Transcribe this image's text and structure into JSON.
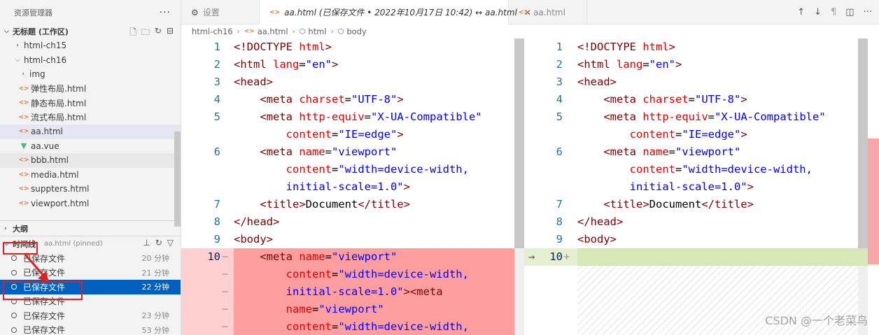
{
  "sidebar": {
    "title": "资源管理器",
    "more": "···",
    "workspace": "无标题 (工作区)",
    "items": [
      {
        "label": "html-ch15",
        "type": "folder",
        "open": false,
        "indent": 1
      },
      {
        "label": "html-ch16",
        "type": "folder",
        "open": true,
        "indent": 1
      },
      {
        "label": "img",
        "type": "folder",
        "open": false,
        "indent": 2
      },
      {
        "label": "弹性布局.html",
        "type": "html",
        "indent": 2
      },
      {
        "label": "静态布局.html",
        "type": "html",
        "indent": 2
      },
      {
        "label": "流式布局.html",
        "type": "html",
        "indent": 2
      },
      {
        "label": "aa.html",
        "type": "html",
        "indent": 2,
        "selected": true
      },
      {
        "label": "aa.vue",
        "type": "vue",
        "indent": 2
      },
      {
        "label": "bbb.html",
        "type": "html",
        "indent": 2,
        "hover": true
      },
      {
        "label": "media.html",
        "type": "html",
        "indent": 2
      },
      {
        "label": "suppters.html",
        "type": "html",
        "indent": 2
      },
      {
        "label": "viewport.html",
        "type": "html",
        "indent": 2
      }
    ],
    "outline_label": "大纲",
    "timeline_label": "时间线",
    "timeline_sub": "aa.html (pinned)",
    "timeline": [
      {
        "label": "已保存文件",
        "ago": "20 分钟"
      },
      {
        "label": "已保存文件",
        "ago": "21 分钟"
      },
      {
        "label": "已保存文件",
        "ago": "22 分钟",
        "active": true
      },
      {
        "label": "已保存文件",
        "ago": ""
      },
      {
        "label": "已保存文件",
        "ago": "23 分钟"
      },
      {
        "label": "已保存文件",
        "ago": "53 分钟"
      }
    ]
  },
  "tabs": [
    {
      "label": "设置",
      "icon": "gear-icon"
    },
    {
      "label": "aa.html (已保存文件 • 2022年10月17日 10:42) ↔ aa.html",
      "active": true
    },
    {
      "label": "aa.html"
    }
  ],
  "breadcrumb": [
    "html-ch16",
    "aa.html",
    "html",
    "body"
  ],
  "left_lines": [
    {
      "n": "1",
      "html": "<span class='t'>&lt;!DOCTYPE </span><span class='a'>html</span><span class='t'>&gt;</span>"
    },
    {
      "n": "2",
      "html": "<span class='t'>&lt;html </span><span class='a'>lang</span><span class='x'>=</span><span class='v'>\"en\"</span><span class='t'>&gt;</span>"
    },
    {
      "n": "3",
      "html": "<span class='t'>&lt;head&gt;</span>"
    },
    {
      "n": "4",
      "html": "    <span class='t'>&lt;meta </span><span class='a'>charset</span><span class='x'>=</span><span class='v'>\"UTF-8\"</span><span class='t'>&gt;</span>"
    },
    {
      "n": "5",
      "html": "    <span class='t'>&lt;meta </span><span class='a'>http-equiv</span><span class='x'>=</span><span class='v'>\"X-UA-Compatible\"</span>"
    },
    {
      "n": "",
      "html": "        <span class='a'>content</span><span class='x'>=</span><span class='v'>\"IE=edge\"</span><span class='t'>&gt;</span>"
    },
    {
      "n": "6",
      "html": "    <span class='t'>&lt;meta </span><span class='a'>name</span><span class='x'>=</span><span class='v'>\"viewport\"</span>"
    },
    {
      "n": "",
      "html": "        <span class='a'>content</span><span class='x'>=</span><span class='v'>\"width=device-width,</span>"
    },
    {
      "n": "",
      "html": "        <span class='v'>initial-scale=1.0\"</span><span class='t'>&gt;</span>"
    },
    {
      "n": "7",
      "html": "    <span class='t'>&lt;title&gt;</span><span class='x'>Document</span><span class='t'>&lt;/title&gt;</span>"
    },
    {
      "n": "8",
      "html": "<span class='t'>&lt;/head&gt;</span>"
    },
    {
      "n": "9",
      "html": "<span class='t'>&lt;body&gt;</span>"
    },
    {
      "n": "10",
      "mk": "−",
      "html": "    <span class='t'>&lt;meta </span><span class='a'>name</span><span class='x'>=</span><span class='v'>\"viewport\"</span>"
    },
    {
      "n": "",
      "mk": "−",
      "html": "        <span class='a'>content</span><span class='x'>=</span><span class='v'>\"width=device-width,</span>"
    },
    {
      "n": "",
      "mk": "−",
      "html": "        <span class='v'>initial-scale=1.0\"</span><span class='t'>&gt;&lt;meta</span>"
    },
    {
      "n": "",
      "mk": "−",
      "html": "        <span class='a'>name</span><span class='x'>=</span><span class='v'>\"viewport\"</span>"
    },
    {
      "n": "",
      "mk": "−",
      "html": "        <span class='a'>content</span><span class='x'>=</span><span class='v'>\"width=device-width,</span>"
    }
  ],
  "right_lines": [
    {
      "n": "1",
      "html": "<span class='t'>&lt;!DOCTYPE </span><span class='a'>html</span><span class='t'>&gt;</span>"
    },
    {
      "n": "2",
      "html": "<span class='t'>&lt;html </span><span class='a'>lang</span><span class='x'>=</span><span class='v'>\"en\"</span><span class='t'>&gt;</span>"
    },
    {
      "n": "3",
      "html": "<span class='t'>&lt;head&gt;</span>"
    },
    {
      "n": "4",
      "html": "    <span class='t'>&lt;meta </span><span class='a'>charset</span><span class='x'>=</span><span class='v'>\"UTF-8\"</span><span class='t'>&gt;</span>"
    },
    {
      "n": "5",
      "html": "    <span class='t'>&lt;meta </span><span class='a'>http-equiv</span><span class='x'>=</span><span class='v'>\"X-UA-Compatible\"</span>"
    },
    {
      "n": "",
      "html": "        <span class='a'>content</span><span class='x'>=</span><span class='v'>\"IE=edge\"</span><span class='t'>&gt;</span>"
    },
    {
      "n": "6",
      "html": "    <span class='t'>&lt;meta </span><span class='a'>name</span><span class='x'>=</span><span class='v'>\"viewport\"</span>"
    },
    {
      "n": "",
      "html": "        <span class='a'>content</span><span class='x'>=</span><span class='v'>\"width=device-width,</span>"
    },
    {
      "n": "",
      "html": "        <span class='v'>initial-scale=1.0\"</span><span class='t'>&gt;</span>"
    },
    {
      "n": "7",
      "html": "    <span class='t'>&lt;title&gt;</span><span class='x'>Document</span><span class='t'>&lt;/title&gt;</span>"
    },
    {
      "n": "8",
      "html": "<span class='t'>&lt;/head&gt;</span>"
    },
    {
      "n": "9",
      "html": "<span class='t'>&lt;body&gt;</span>"
    },
    {
      "n": "10",
      "mk": "+",
      "arrow": "→",
      "html": ""
    }
  ],
  "watermark": "CSDN @一个老菜鸟",
  "colors": {
    "accent": "#0060c0",
    "deleted": "#ff9e9e",
    "inserted": "#d6e8b6",
    "annotation": "#e02020"
  }
}
